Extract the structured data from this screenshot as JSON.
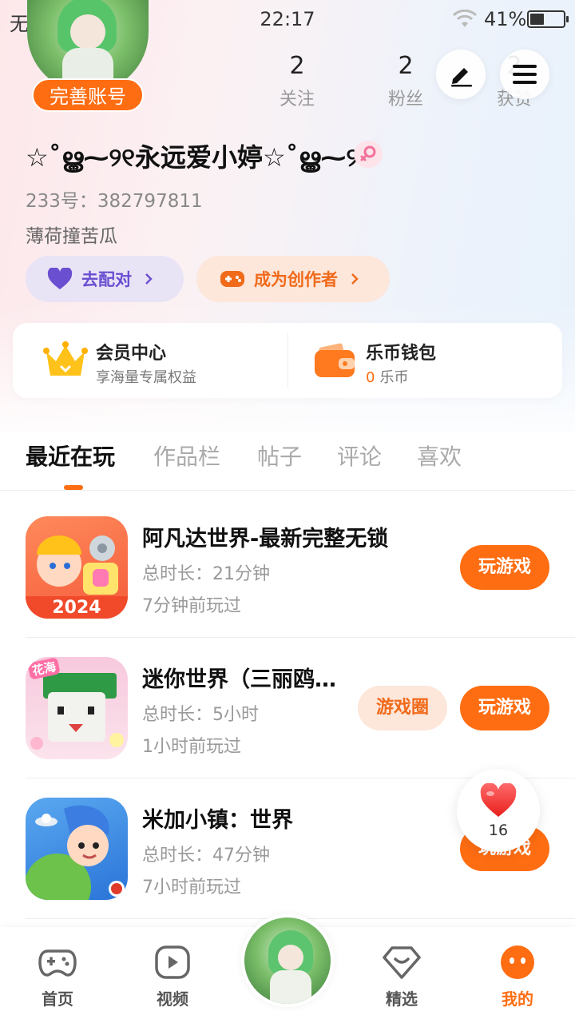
{
  "status_bar": {
    "carrier": "无SIM",
    "time": "22:17",
    "battery": "41%"
  },
  "profile": {
    "perfect_account_label": "完善账号",
    "nickname": "☆˚ൠ⁓୨୧永远爱小婷☆˚ൠ⁓୨",
    "uid": "233号：382797811",
    "bio": "薄荷撞苦瓜",
    "stats": [
      {
        "value": "2",
        "label": "关注"
      },
      {
        "value": "2",
        "label": "粉丝"
      },
      {
        "value": "2",
        "label": "获赞"
      }
    ],
    "match_label": "去配对",
    "creator_label": "成为创作者"
  },
  "cards": {
    "vip": {
      "title": "会员中心",
      "subtitle": "享海量专属权益"
    },
    "wallet": {
      "title": "乐币钱包",
      "amount": "0",
      "unit": "乐币"
    }
  },
  "tabs": [
    "最近在玩",
    "作品栏",
    "帖子",
    "评论",
    "喜欢"
  ],
  "games": [
    {
      "name": "阿凡达世界-最新完整无锁",
      "duration": "总时长：21分钟",
      "last_played": "7分钟前玩过",
      "play_label": "玩游戏",
      "icon_text": "2024"
    },
    {
      "name": "迷你世界（三丽鸥…",
      "duration": "总时长：5小时",
      "last_played": "1小时前玩过",
      "play_label": "玩游戏",
      "circle_label": "游戏圈",
      "icon_text": "花海"
    },
    {
      "name": "米加小镇：世界",
      "duration": "总时长：47分钟",
      "last_played": "7小时前玩过",
      "play_label": "玩游戏"
    }
  ],
  "like_float": {
    "count": "16"
  },
  "bottom_nav": [
    {
      "label": "首页"
    },
    {
      "label": "视频"
    },
    {
      "label": "精选"
    },
    {
      "label": "我的"
    }
  ],
  "colors": {
    "accent": "#ff6d12",
    "match_purple": "#6a4fd1"
  }
}
